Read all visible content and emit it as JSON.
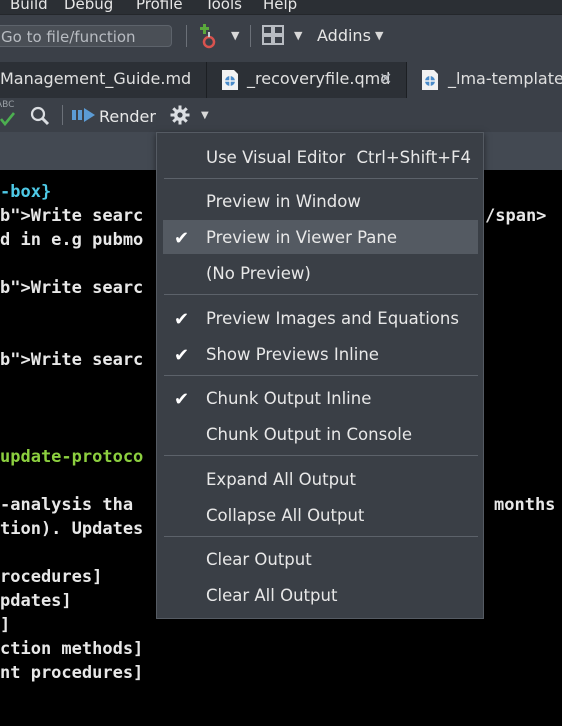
{
  "menubar": [
    "Build",
    "Debug",
    "Profile",
    "Tools",
    "Help"
  ],
  "toolbar": {
    "goto_placeholder": "Go to file/function",
    "addins_label": "Addins"
  },
  "tabs": [
    "Management_Guide.md",
    "_recoveryfile.qmd",
    "_lma-template.q"
  ],
  "editor_toolbar": {
    "spell_label": "ABC",
    "render_label": "Render"
  },
  "code_lines": [
    "-box}",
    "b\">Write searc",
    "d in e.g pubmo",
    "b\">Write searc",
    "b\">Write searc",
    "update-protoco",
    "-analysis tha",
    "tion). Updates",
    "rocedures]",
    "pdates]",
    "]",
    "ction methods]",
    "nt procedures]"
  ],
  "code_right": [
    "/span>",
    "months"
  ],
  "menu": {
    "items": [
      {
        "label": "Use Visual Editor",
        "shortcut": "Ctrl+Shift+F4",
        "checked": false
      },
      {
        "label": "Preview in Window",
        "checked": false
      },
      {
        "label": "Preview in Viewer Pane",
        "checked": true,
        "highlighted": true
      },
      {
        "label": "(No Preview)",
        "checked": false
      },
      {
        "label": "Preview Images and Equations",
        "checked": true
      },
      {
        "label": "Show Previews Inline",
        "checked": true
      },
      {
        "label": "Chunk Output Inline",
        "checked": true
      },
      {
        "label": "Chunk Output in Console",
        "checked": false
      },
      {
        "label": "Expand All Output",
        "checked": false
      },
      {
        "label": "Collapse All Output",
        "checked": false
      },
      {
        "label": "Clear Output",
        "checked": false
      },
      {
        "label": "Clear All Output",
        "checked": false
      }
    ]
  },
  "colors": {
    "cyan": "#4ec9e6",
    "green": "#8ccf3f",
    "text": "#e8e8e8",
    "menu_bg": "#3a3f46",
    "highlight": "#545a62"
  }
}
